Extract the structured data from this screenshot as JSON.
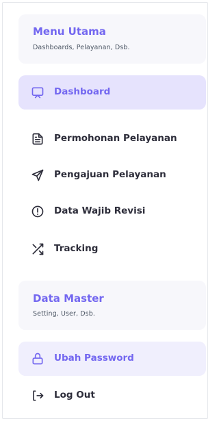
{
  "menu_utama": {
    "title": "Menu Utama",
    "subtitle": "Dashboards, Pelayanan, Dsb."
  },
  "nav_items": [
    {
      "label": "Dashboard",
      "icon": "monitor-icon",
      "active": true
    },
    {
      "label": "Permohonan Pelayanan",
      "icon": "document-icon"
    },
    {
      "label": "Pengajuan Pelayanan",
      "icon": "send-icon"
    },
    {
      "label": "Data Wajib Revisi",
      "icon": "alert-circle-icon"
    },
    {
      "label": "Tracking",
      "icon": "shuffle-icon"
    }
  ],
  "data_master": {
    "title": "Data Master",
    "subtitle": "Setting, User, Dsb."
  },
  "account_items": [
    {
      "label": "Ubah Password",
      "icon": "lock-icon"
    },
    {
      "label": "Log Out",
      "icon": "logout-icon"
    }
  ],
  "colors": {
    "accent": "#7367f0",
    "active_bg": "#e6e3fd",
    "card_bg": "#f7f7fb"
  }
}
